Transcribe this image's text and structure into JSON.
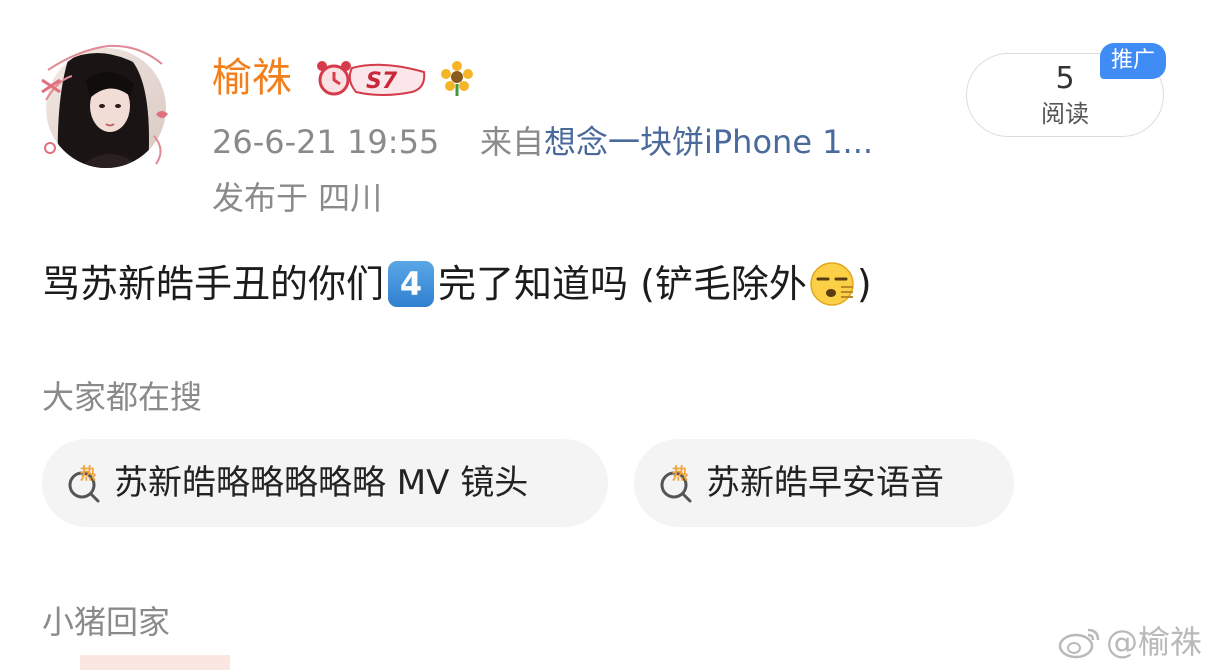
{
  "post": {
    "username": "榆祩",
    "level_badge": "S7",
    "timestamp": "26-6-21 19:55",
    "from_prefix": "来自",
    "from_app": "想念一块饼iPhone 1...",
    "location": "发布于 四川",
    "text_before": "骂苏新皓手丑的你们",
    "keycap_number": "4",
    "text_after": "完了知道吗 (铲毛除外",
    "text_end": ")",
    "emoji": "sleepy-yawning-face"
  },
  "reads": {
    "count": "5",
    "label": "阅读",
    "promo_label": "推广"
  },
  "hot_search": {
    "title": "大家都在搜",
    "items": [
      {
        "label": "苏新皓略略略略略 MV 镜头",
        "icon_text": "热"
      },
      {
        "label": "苏新皓早安语音",
        "icon_text": "热"
      }
    ]
  },
  "next_section": {
    "title": "小猪回家"
  },
  "watermark": {
    "text": "@榆祩"
  },
  "colors": {
    "username": "#f27f1b",
    "app_link": "#4a6a9c",
    "promo_badge": "#3f8cf5",
    "meta_text": "#8a8a8a",
    "chip_bg": "#f4f4f4",
    "hot_icon": "#f2a33a"
  }
}
